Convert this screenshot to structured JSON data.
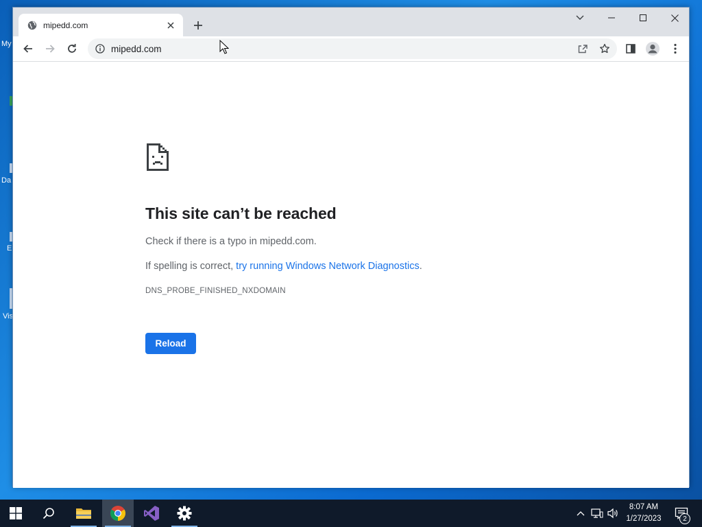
{
  "desktop": {
    "icons": [
      {
        "label": "My"
      },
      {
        "label": "Da"
      },
      {
        "label": "E"
      },
      {
        "label": "Vis"
      }
    ]
  },
  "browser": {
    "tab": {
      "title": "mipedd.com",
      "favicon": "globe-icon"
    },
    "address": {
      "url": "mipedd.com"
    }
  },
  "error_page": {
    "title": "This site can’t be reached",
    "line1": "Check if there is a typo in mipedd.com.",
    "line2_prefix": "If spelling is correct, ",
    "line2_link": "try running Windows Network Diagnostics",
    "line2_suffix": ".",
    "error_code": "DNS_PROBE_FINISHED_NXDOMAIN",
    "reload_label": "Reload"
  },
  "taskbar": {
    "time": "8:07 AM",
    "date": "1/27/2023",
    "notification_count": "2"
  },
  "colors": {
    "accent": "#1a73e8",
    "link": "#1a73e8"
  }
}
